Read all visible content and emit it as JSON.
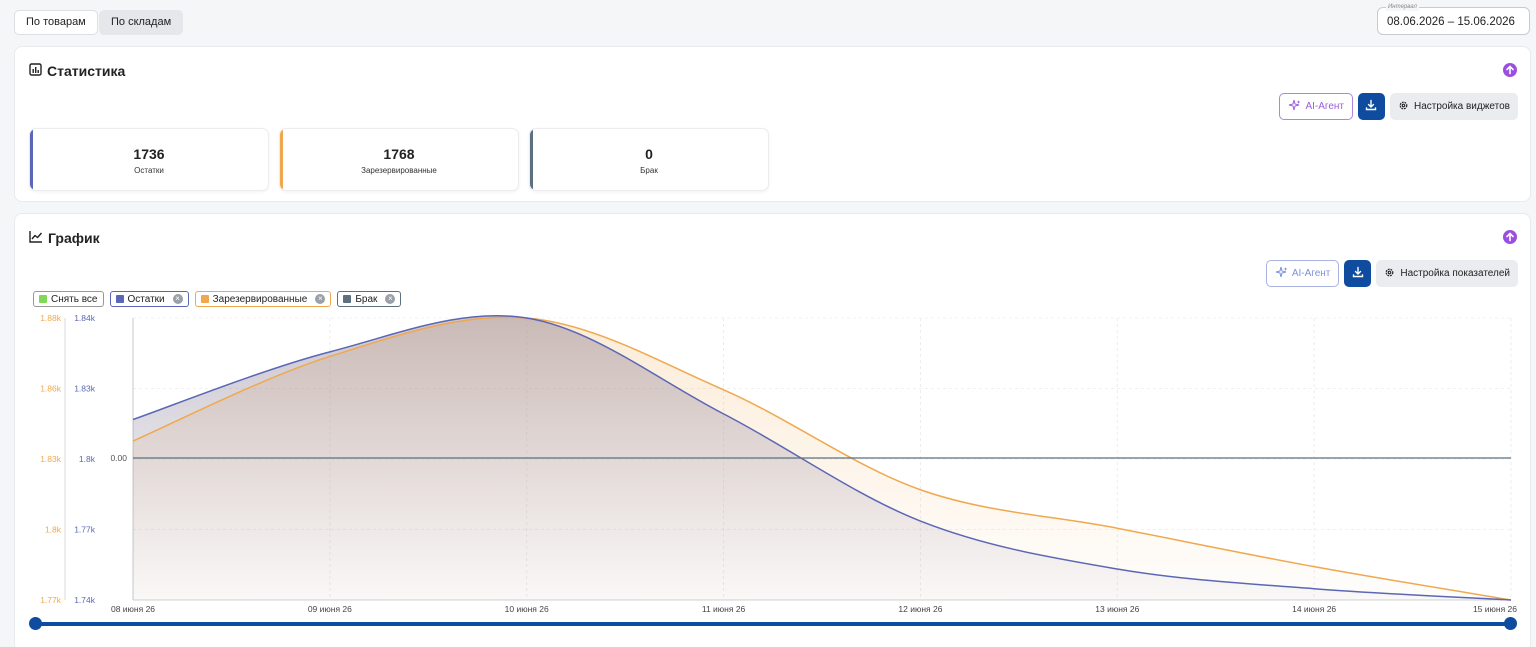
{
  "tabs": [
    {
      "label": "По товарам",
      "active": false
    },
    {
      "label": "По складам",
      "active": true
    }
  ],
  "interval": {
    "label": "Интервал",
    "value": "08.06.2026 – 15.06.2026"
  },
  "stats_panel": {
    "title": "Статистика",
    "ai_label": "AI-Агент",
    "settings_label": "Настройка виджетов",
    "cards": [
      {
        "value": "1736",
        "caption": "Остатки",
        "color": "#5b67b5"
      },
      {
        "value": "1768",
        "caption": "Зарезервированные",
        "color": "#f0a84e"
      },
      {
        "value": "0",
        "caption": "Брак",
        "color": "#5c7080"
      }
    ]
  },
  "chart_panel": {
    "title": "График",
    "ai_label": "AI-Агент",
    "settings_label": "Настройка показателей",
    "legend": [
      {
        "label": "Снять все",
        "color": "#7ed957",
        "removable": false
      },
      {
        "label": "Остатки",
        "color": "#5b67b5",
        "removable": true
      },
      {
        "label": "Зарезервированные",
        "color": "#f0a84e",
        "removable": true
      },
      {
        "label": "Брак",
        "color": "#5c7080",
        "removable": true
      }
    ]
  },
  "chart_data": {
    "type": "area",
    "x": [
      "08 июня 26",
      "09 июня 26",
      "10 июня 26",
      "11 июня 26",
      "12 июня 26",
      "13 июня 26",
      "14 июня 26",
      "15 июня 26"
    ],
    "series": [
      {
        "name": "Остатки",
        "color": "#5b67b5",
        "axis": "y1",
        "values": [
          1804,
          1828,
          1840,
          1806,
          1768,
          1751,
          1744,
          1740
        ]
      },
      {
        "name": "Зарезервированные",
        "color": "#f0a84e",
        "axis": "y2",
        "values": [
          1830,
          1863,
          1878,
          1850,
          1811,
          1796,
          1781,
          1768
        ]
      },
      {
        "name": "Брак",
        "color": "#5c7080",
        "axis": "y3",
        "values": [
          0,
          0,
          0,
          0,
          0,
          0,
          0,
          0
        ]
      }
    ],
    "y1_ticks": [
      "1.84k",
      "1.83k",
      "1.8k",
      "1.77k",
      "1.74k"
    ],
    "y1_range": [
      1740,
      1840
    ],
    "y2_ticks": [
      "1.88k",
      "1.86k",
      "1.83k",
      "1.8k",
      "1.77k"
    ],
    "y2_range": [
      1768,
      1878
    ],
    "y3_ticks": [
      "0.00"
    ],
    "grid": true,
    "legend_position": "top-left"
  }
}
